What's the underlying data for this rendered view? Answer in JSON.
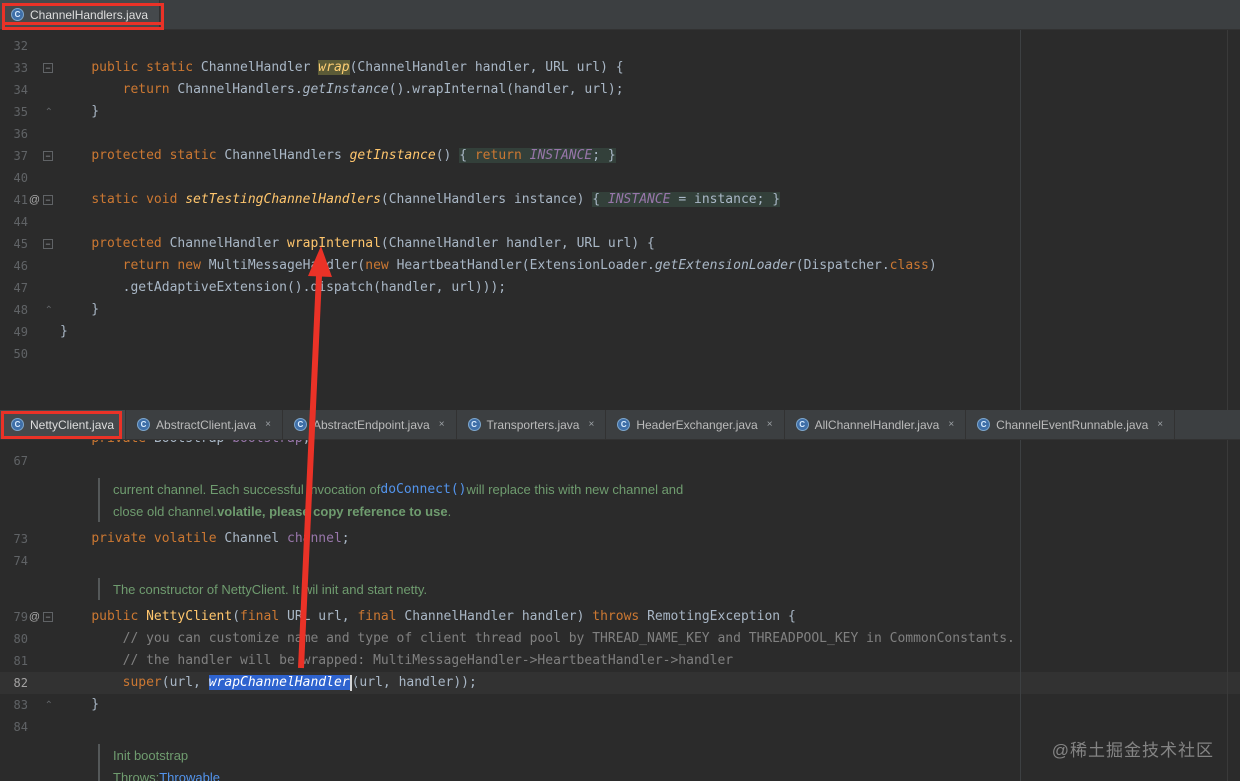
{
  "colors": {
    "background": "#2b2b2b",
    "tab_bar": "#3c3f41",
    "keyword": "#cc7832",
    "method": "#ffc66d",
    "field": "#9876aa",
    "comment": "#808080",
    "doc_comment": "#6f9c6f",
    "link": "#5394ec",
    "selection": "#2e63cf",
    "annotation_red": "#ea3227"
  },
  "watermark": "@稀土掘金技术社区",
  "top_tab_bar": {
    "tabs": [
      {
        "label": "ChannelHandlers.java",
        "active": true,
        "close": false
      }
    ]
  },
  "bottom_tab_bar": {
    "tabs": [
      {
        "label": "NettyClient.java",
        "active": true,
        "close": false
      },
      {
        "label": "AbstractClient.java",
        "active": false,
        "close": true
      },
      {
        "label": "AbstractEndpoint.java",
        "active": false,
        "close": true
      },
      {
        "label": "Transporters.java",
        "active": false,
        "close": true
      },
      {
        "label": "HeaderExchanger.java",
        "active": false,
        "close": true
      },
      {
        "label": "AllChannelHandler.java",
        "active": false,
        "close": true
      },
      {
        "label": "ChannelEventRunnable.java",
        "active": false,
        "close": true
      }
    ]
  },
  "top_editor": {
    "rows": [
      {
        "n": "32"
      },
      {
        "n": "33",
        "g": [
          "fold"
        ],
        "t": [
          [
            "pl",
            "    "
          ],
          [
            "kw",
            "public static "
          ],
          [
            "pl",
            "ChannelHandler "
          ],
          [
            "mth stc hlwrap",
            "wrap"
          ],
          [
            "pl",
            "(ChannelHandler handler, URL url) {"
          ]
        ]
      },
      {
        "n": "34",
        "t": [
          [
            "pl",
            "        "
          ],
          [
            "kw",
            "return "
          ],
          [
            "pl",
            "ChannelHandlers."
          ],
          [
            "stc",
            "getInstance"
          ],
          [
            "pl",
            "().wrapInternal(handler, url);"
          ]
        ]
      },
      {
        "n": "35",
        "g": [
          "chev"
        ],
        "t": [
          [
            "pl",
            "    }"
          ]
        ]
      },
      {
        "n": "36"
      },
      {
        "n": "37",
        "g": [
          "fold"
        ],
        "t": [
          [
            "pl",
            "    "
          ],
          [
            "kw",
            "protected static "
          ],
          [
            "pl",
            "ChannelHandlers "
          ],
          [
            "mth stc",
            "getInstance"
          ],
          [
            "pl",
            "() "
          ],
          [
            "pl fd",
            "{ "
          ],
          [
            "kw fd",
            "return "
          ],
          [
            "fldst fd",
            "INSTANCE"
          ],
          [
            "pl fd",
            "; }"
          ]
        ]
      },
      {
        "n": "40"
      },
      {
        "n": "41",
        "g": [
          "at",
          "fold"
        ],
        "t": [
          [
            "pl",
            "    "
          ],
          [
            "kw",
            "static void "
          ],
          [
            "mth stc",
            "setTestingChannelHandlers"
          ],
          [
            "pl",
            "(ChannelHandlers instance) "
          ],
          [
            "pl fd",
            "{ "
          ],
          [
            "fldst fd",
            "INSTANCE"
          ],
          [
            "pl fd",
            " = instance; }"
          ]
        ]
      },
      {
        "n": "44"
      },
      {
        "n": "45",
        "g": [
          "fold"
        ],
        "t": [
          [
            "pl",
            "    "
          ],
          [
            "kw",
            "protected "
          ],
          [
            "pl",
            "ChannelHandler "
          ],
          [
            "mth",
            "wrapInternal"
          ],
          [
            "pl",
            "(ChannelHandler handler, URL url) {"
          ]
        ]
      },
      {
        "n": "46",
        "t": [
          [
            "pl",
            "        "
          ],
          [
            "kw",
            "return new "
          ],
          [
            "pl",
            "MultiMessageHandler("
          ],
          [
            "kw",
            "new "
          ],
          [
            "pl",
            "HeartbeatHandler(ExtensionLoader."
          ],
          [
            "stc",
            "getExtensionLoader"
          ],
          [
            "pl",
            "(Dispatcher."
          ],
          [
            "kw",
            "class"
          ],
          [
            "pl",
            ")"
          ]
        ]
      },
      {
        "n": "47",
        "t": [
          [
            "pl",
            "        .getAdaptiveExtension().dispatch(handler, url)));"
          ]
        ]
      },
      {
        "n": "48",
        "g": [
          "chev"
        ],
        "t": [
          [
            "pl",
            "    }"
          ]
        ]
      },
      {
        "n": "49",
        "t": [
          [
            "pl",
            "}"
          ]
        ]
      },
      {
        "n": "50"
      }
    ]
  },
  "bottom_editor": {
    "rows": [
      {
        "n": "",
        "t": [
          [
            "pl",
            "    "
          ],
          [
            "kw",
            "private "
          ],
          [
            "pl",
            "Bootstrap "
          ],
          [
            "fld",
            "bootstrap"
          ],
          [
            "pl",
            ";"
          ]
        ]
      },
      {
        "n": "67"
      },
      {
        "kind": "doc",
        "rows": [
          [
            [
              "doc",
              "current channel. Each successful invocation of "
            ],
            [
              "doclink doccode",
              "doConnect()"
            ],
            [
              "doc",
              " will replace this with new channel and"
            ]
          ],
          [
            [
              "doc",
              "close old channel. "
            ],
            [
              "doc docb",
              "volatile, please copy reference to use"
            ],
            [
              "doc",
              "."
            ]
          ]
        ]
      },
      {
        "n": "73",
        "t": [
          [
            "pl",
            "    "
          ],
          [
            "kw",
            "private volatile "
          ],
          [
            "pl",
            "Channel "
          ],
          [
            "fld",
            "channel"
          ],
          [
            "pl",
            ";"
          ]
        ]
      },
      {
        "n": "74"
      },
      {
        "kind": "doc",
        "rows": [
          [
            [
              "doc",
              "The constructor of NettyClient. It wil init and start netty."
            ]
          ]
        ]
      },
      {
        "n": "79",
        "g": [
          "at",
          "fold"
        ],
        "t": [
          [
            "pl",
            "    "
          ],
          [
            "kw",
            "public "
          ],
          [
            "mth",
            "NettyClient"
          ],
          [
            "pl",
            "("
          ],
          [
            "kw",
            "final "
          ],
          [
            "pl",
            "URL url, "
          ],
          [
            "kw",
            "final "
          ],
          [
            "pl",
            "ChannelHandler handler) "
          ],
          [
            "kw",
            "throws "
          ],
          [
            "pl",
            "RemotingException {"
          ]
        ]
      },
      {
        "n": "80",
        "t": [
          [
            "cmt",
            "        // you can customize name and type of client thread pool by THREAD_NAME_KEY and THREADPOOL_KEY in CommonConstants."
          ]
        ]
      },
      {
        "n": "81",
        "t": [
          [
            "cmt",
            "        // the handler will be wrapped: MultiMessageHandler->HeartbeatHandler->handler"
          ]
        ]
      },
      {
        "n": "82",
        "cls": "cur",
        "t": [
          [
            "kw",
            "        super"
          ],
          [
            "pl",
            "(url, "
          ],
          [
            "sel stc",
            "wrapChannelHandler"
          ],
          [
            "caret",
            ""
          ],
          [
            "pl",
            "(url, handler));"
          ]
        ]
      },
      {
        "n": "83",
        "g": [
          "chev"
        ],
        "t": [
          [
            "pl",
            "    }"
          ]
        ]
      },
      {
        "n": "84"
      },
      {
        "kind": "doc",
        "rows": [
          [
            [
              "doc",
              "Init bootstrap"
            ]
          ],
          [
            [
              "doc",
              "Throws: "
            ],
            [
              "doclink",
              "Throwable"
            ]
          ]
        ]
      }
    ]
  }
}
